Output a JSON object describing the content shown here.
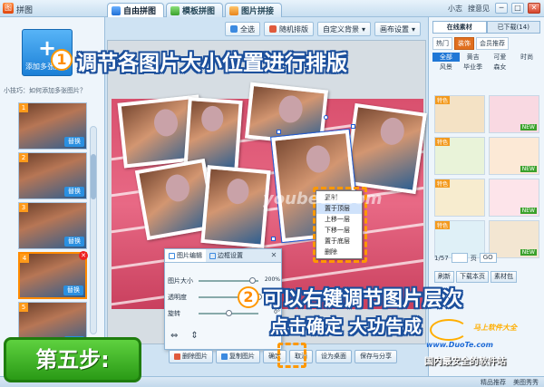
{
  "window": {
    "app_title": "拼图",
    "tabs": [
      {
        "label": "自由拼图",
        "active": true
      },
      {
        "label": "模板拼图",
        "active": false
      },
      {
        "label": "图片拼接",
        "active": false
      }
    ],
    "user": "小志",
    "login": "搜意见",
    "min": "─",
    "max": "□",
    "close": "✕"
  },
  "left": {
    "add_label": "添加多张图片",
    "tip": "小技巧：如何添加多张图片？",
    "swap_label": "替换",
    "thumbs": [
      {
        "num": "1"
      },
      {
        "num": "2"
      },
      {
        "num": "3"
      },
      {
        "num": "4",
        "selected": true
      },
      {
        "num": "5"
      }
    ]
  },
  "toolbar": {
    "select_all": "全选",
    "random_layout": "随机排版",
    "custom_bg": "自定义背景",
    "canvas_settings": "画布设置"
  },
  "context_menu": {
    "items": [
      "复制",
      "置于顶层",
      "上移一层",
      "下移一层",
      "置于底层",
      "删除"
    ]
  },
  "edit_panel": {
    "tab_edit": "图片编辑",
    "tab_border": "边框设置",
    "close": "✕",
    "size_label": "图片大小",
    "size_value": "200%",
    "size_ratio": 0.9,
    "opacity_label": "透明度",
    "opacity_ratio": 1.0,
    "rotate_label": "旋转",
    "rotate_value": "0°",
    "rotate_ratio": 0.5,
    "flip_h": "⇔",
    "flip_v": "⇕"
  },
  "bottom": {
    "delete": "删除图片",
    "copy": "复制图片",
    "ok": "确定",
    "cancel": "取消",
    "set_desktop": "设为桌面",
    "save_share": "保存与分享"
  },
  "right": {
    "tab_online": "在线素材",
    "tab_downloaded": "已下载(14)",
    "categories": [
      "热门",
      "装饰",
      "会员推荐"
    ],
    "active_category": "装饰",
    "subcats": [
      "全部",
      "黄吉",
      "可爱",
      "时尚",
      "风景",
      "毕业季",
      "森女"
    ],
    "active_subcat": "全部",
    "new_label": "NEW",
    "badge_label": "特色",
    "tile_colors": [
      "#f4e2c5",
      "#f9d9e2",
      "#e9f3d9",
      "#fce9d6",
      "#f7eccf",
      "#fde4ea",
      "#dff0f7",
      "#f3e6d2"
    ],
    "page_info": "1/57",
    "page_label": "页",
    "go": "GO",
    "refresh": "刷新",
    "download_page": "下载本页",
    "material_pack": "素材包"
  },
  "status": {
    "featured": "精品推荐",
    "photo_beauty": "美图秀秀"
  },
  "annotations": {
    "step1_num": "1",
    "step1_text": "调节各图片大小位置进行排版",
    "step2_num": "2",
    "step2_text_line1": "可以右键调节图片层次",
    "step2_text_line2": "点击确定 大功告成",
    "step_badge": "第五步:"
  },
  "watermarks": {
    "wm_site": "youbete.com",
    "wm_brand": "马上软件大全",
    "wm_domain": "www.DuoTe.com",
    "wm_slogan": "国内最安全的软件站"
  },
  "colors": {
    "accent_orange": "#ff9800",
    "brand_blue": "#1b4f9c",
    "step_green": "#2a9a16"
  }
}
